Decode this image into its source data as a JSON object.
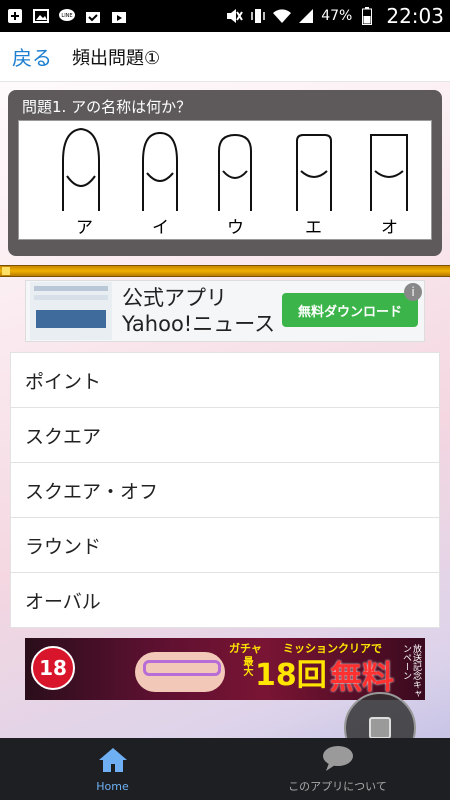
{
  "status_bar": {
    "battery_percent": "47%",
    "time": "22:03",
    "icons": [
      "plus-icon",
      "image-icon",
      "line-icon",
      "check-bag-icon",
      "play-bag-icon",
      "mute-icon",
      "vibrate-icon",
      "wifi-icon",
      "signal-icon",
      "battery-icon"
    ]
  },
  "header": {
    "back_label": "戻る",
    "title": "頻出問題①"
  },
  "question": {
    "text": "問題1. アの名称は何か？",
    "options_labels": [
      "ア",
      "イ",
      "ウ",
      "エ",
      "オ"
    ]
  },
  "progress": {
    "fraction": 0.01
  },
  "ad_top": {
    "line1": "公式アプリ",
    "line2": "Yahoo!ニュース",
    "cta": "無料ダウンロード",
    "info": "i"
  },
  "answers": [
    "ポイント",
    "スクエア",
    "スクエア・オフ",
    "ラウンド",
    "オーバル"
  ],
  "ad_bottom": {
    "badge": "18",
    "gacha": "ガチャ",
    "max": "最大",
    "count": "18回",
    "free": "無料",
    "mission": "ミッションクリアで",
    "campaign": "放送記念キャンペーン"
  },
  "bottom_nav": {
    "home": "Home",
    "about": "このアプリについて"
  },
  "colors": {
    "accent_blue": "#1e7fd0",
    "nav_active": "#6fb0f4",
    "progress": "#f0b000",
    "cta_green": "#3bb54a"
  }
}
